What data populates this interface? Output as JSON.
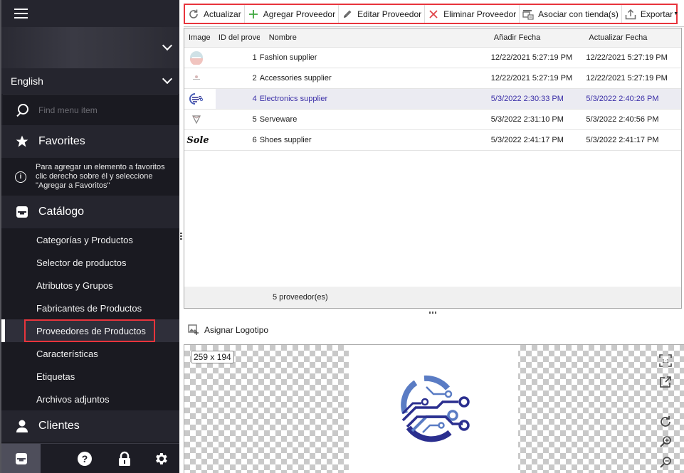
{
  "sidebar": {
    "language": "English",
    "search": {
      "placeholder": "Find menu item",
      "value": ""
    },
    "favorites": {
      "label": "Favorites",
      "hint": "Para agregar un elemento a favoritos clic derecho sobre él y seleccione \"Agregar a Favoritos\""
    },
    "catalog": {
      "label": "Catálogo",
      "items": [
        {
          "label": "Categorías y Productos",
          "active": false
        },
        {
          "label": "Selector de productos",
          "active": false
        },
        {
          "label": "Atributos y Grupos",
          "active": false
        },
        {
          "label": "Fabricantes de Productos",
          "active": false
        },
        {
          "label": "Proveedores de Productos",
          "active": true
        },
        {
          "label": "Características",
          "active": false
        },
        {
          "label": "Etiquetas",
          "active": false
        },
        {
          "label": "Archivos adjuntos",
          "active": false
        }
      ]
    },
    "clients": {
      "label": "Clientes"
    },
    "bottom_icons": [
      "catalog-box-icon",
      "help-icon",
      "lock-icon",
      "gear-icon"
    ]
  },
  "toolbar": {
    "buttons": [
      {
        "label": "Actualizar",
        "icon": "refresh-icon"
      },
      {
        "label": "Agregar Proveedor",
        "icon": "plus-icon"
      },
      {
        "label": "Editar Proveedor",
        "icon": "pencil-icon"
      },
      {
        "label": "Eliminar Proveedor",
        "icon": "x-icon"
      },
      {
        "label": "Asociar con tienda(s)",
        "icon": "store-link-icon"
      },
      {
        "label": "Exportar",
        "icon": "export-icon"
      }
    ]
  },
  "grid": {
    "columns": [
      "Image",
      "ID del prove",
      "Nombre",
      "Añadir Fecha",
      "Actualizar Fecha"
    ],
    "rows": [
      {
        "id": "1",
        "name": "Fashion supplier",
        "added": "12/22/2021 5:27:19 PM",
        "updated": "12/22/2021 5:27:19 PM",
        "logo": "fashion-logo",
        "selected": false
      },
      {
        "id": "2",
        "name": "Accessories supplier",
        "added": "12/22/2021 5:27:19 PM",
        "updated": "12/22/2021 5:27:19 PM",
        "logo": "accessories-logo",
        "selected": false
      },
      {
        "id": "4",
        "name": "Electronics supplier",
        "added": "5/3/2022 2:30:33 PM",
        "updated": "5/3/2022 2:40:26 PM",
        "logo": "electronics-logo",
        "selected": true
      },
      {
        "id": "5",
        "name": "Serveware",
        "added": "5/3/2022 2:31:10 PM",
        "updated": "5/3/2022 2:40:56 PM",
        "logo": "serveware-logo",
        "selected": false
      },
      {
        "id": "6",
        "name": "Shoes supplier",
        "added": "5/3/2022 2:41:17 PM",
        "updated": "5/3/2022 2:41:17 PM",
        "logo": "sole-logo",
        "selected": false
      }
    ],
    "footer": "5 proveedor(es)"
  },
  "logo_panel": {
    "assign_label": "Asignar Logotipo",
    "dimensions": "259 x 194",
    "tools": [
      "actual-size-icon",
      "open-external-icon",
      "rotate-icon",
      "zoom-in-icon",
      "zoom-out-icon"
    ]
  },
  "colors": {
    "sidebar_bg": "#1d1d25",
    "highlight_red": "#e8343c",
    "selected_text": "#3b2fa8",
    "logo_dark_blue": "#2b2f8f",
    "logo_light_blue": "#5a7cc4"
  }
}
